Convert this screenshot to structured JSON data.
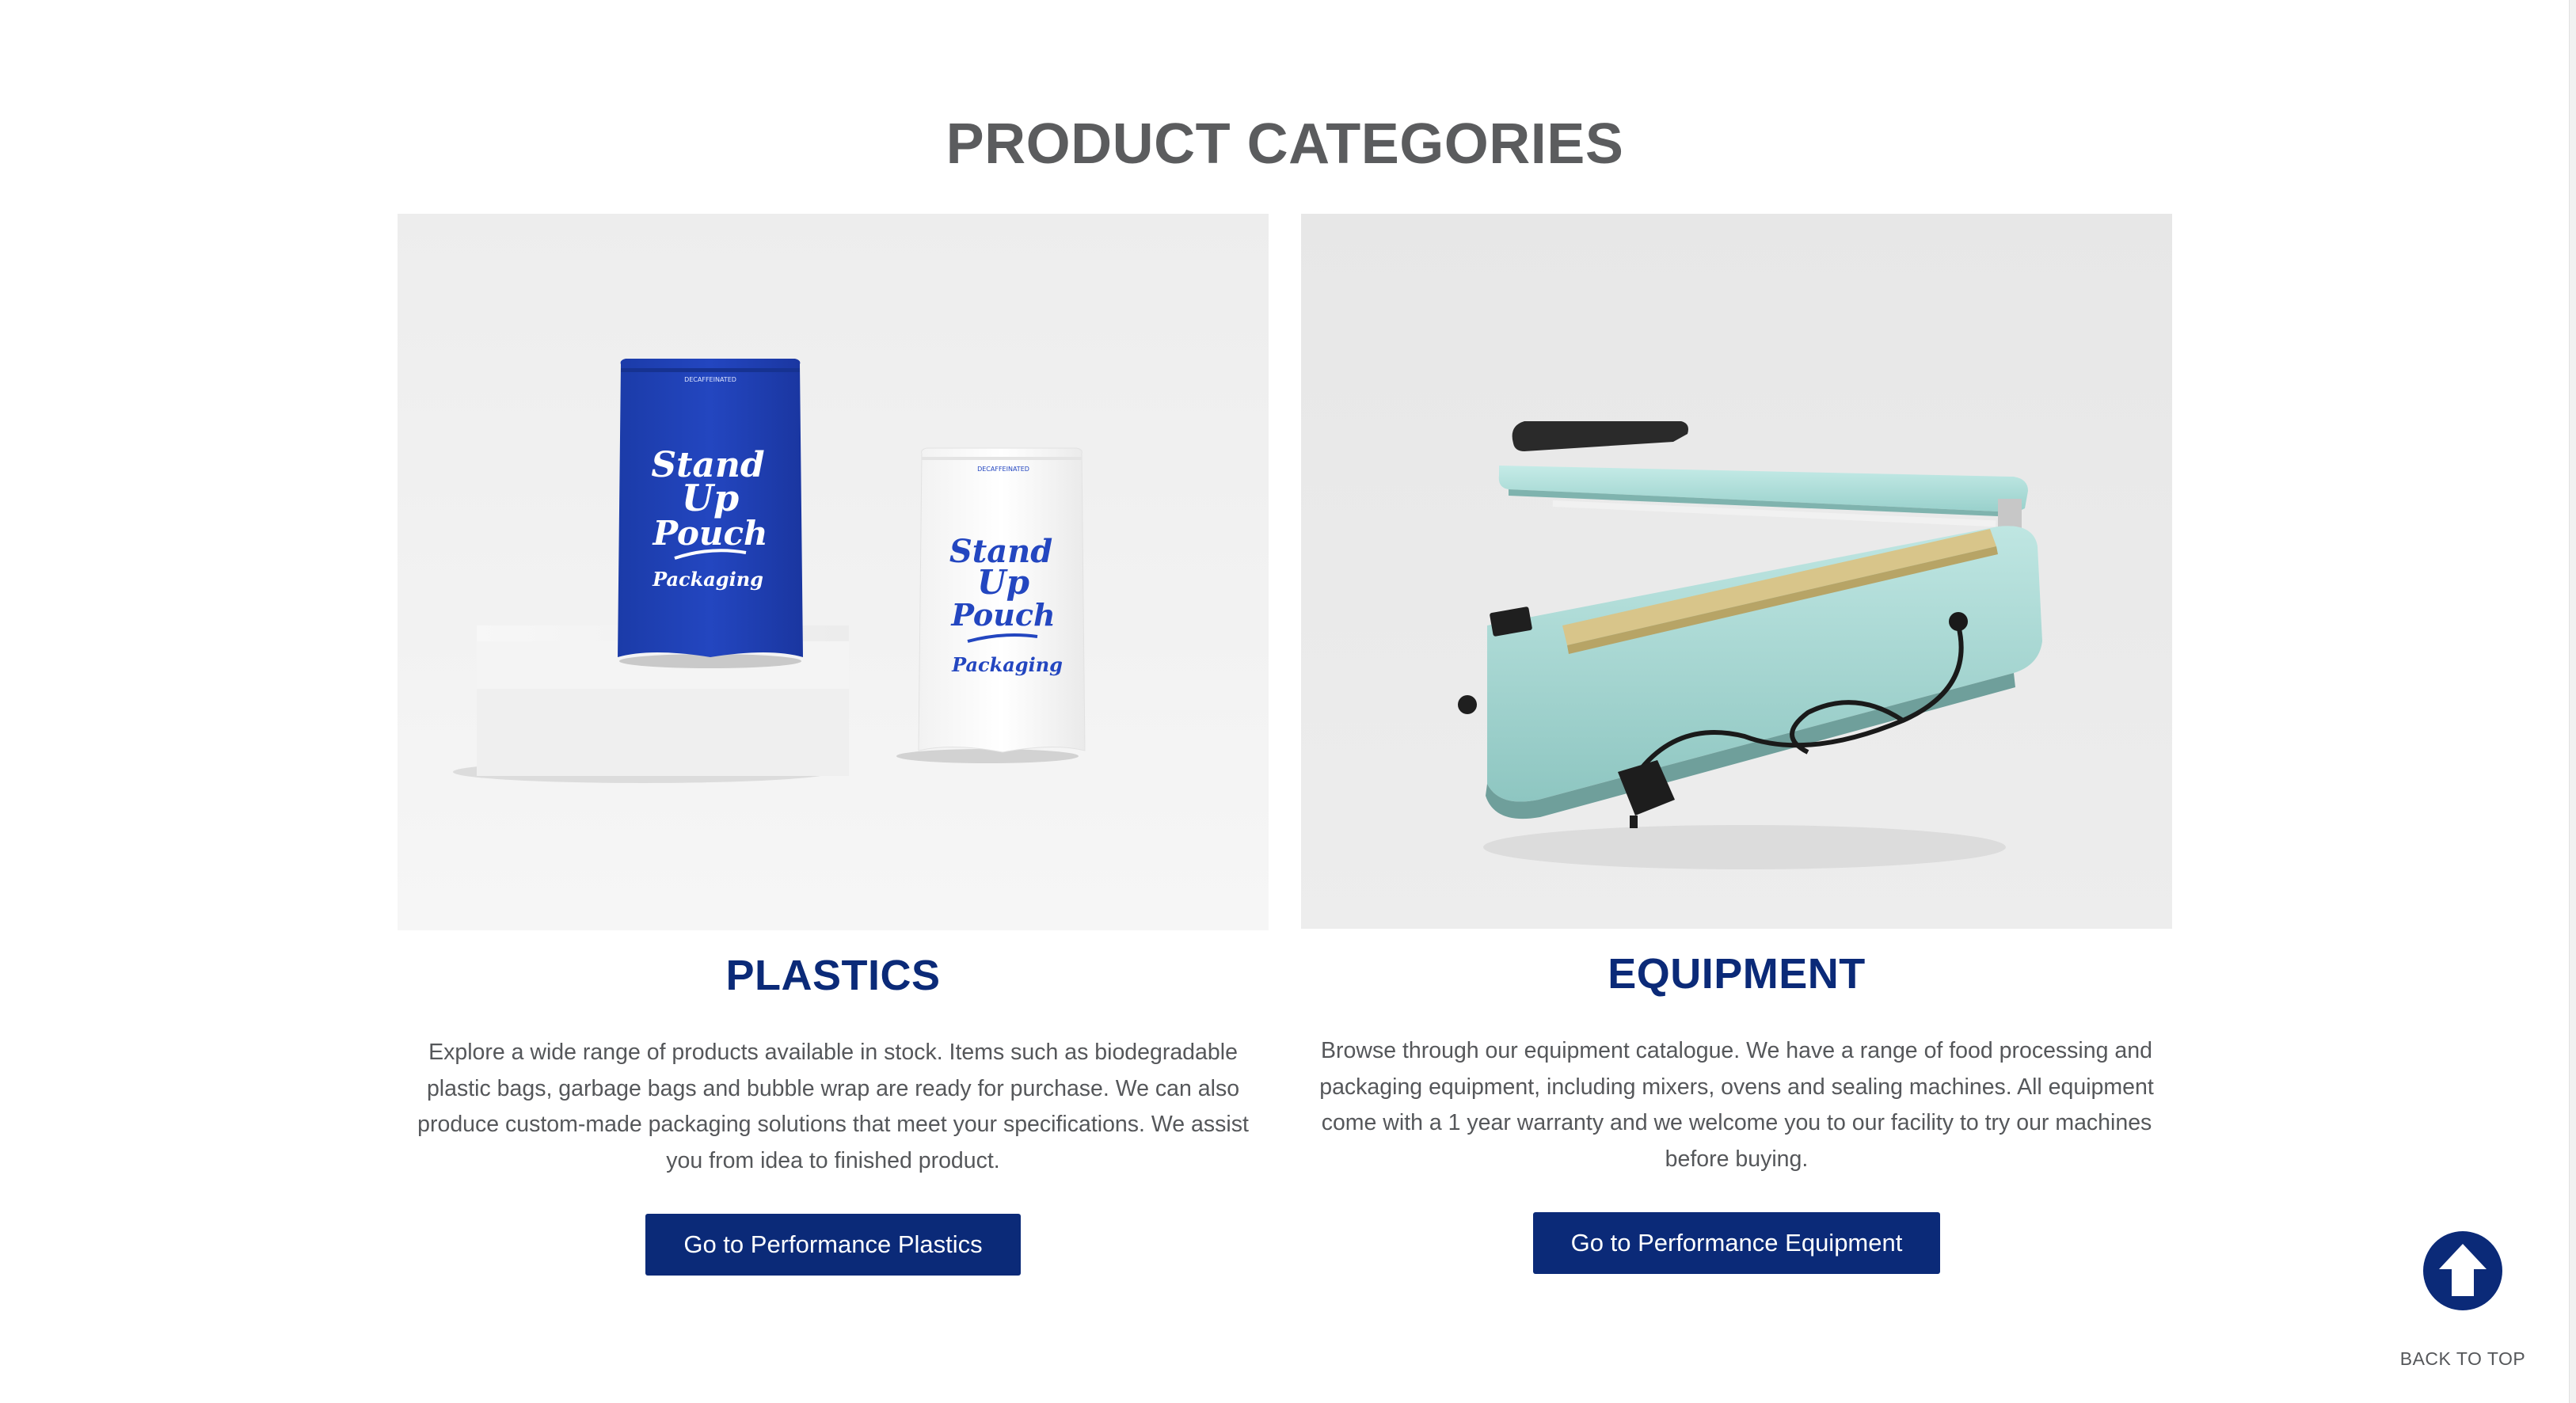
{
  "section": {
    "title": "PRODUCT CATEGORIES"
  },
  "cards": [
    {
      "title": "PLASTICS",
      "description": "Explore a wide range of products available in stock. Items such as biodegradable plastic bags, garbage bags and bubble wrap are ready for purchase. We can also produce custom-made packaging solutions that meet your specifications. We assist you from idea to finished product.",
      "button_label": "Go to Performance Plastics",
      "image": {
        "pouch_top_label": "DECAFFEINATED",
        "pouch_text_line1": "Stand",
        "pouch_text_line2": "Up",
        "pouch_text_line3": "Pouch",
        "pouch_text_line4": "Packaging"
      }
    },
    {
      "title": "EQUIPMENT",
      "description": "Browse through our equipment catalogue. We have a range of food processing and packaging equipment, including mixers, ovens and sealing machines. All equipment come with a 1 year warranty and we welcome you to our facility to try our machines before buying.",
      "button_label": "Go to Performance Equipment"
    }
  ],
  "back_to_top": {
    "label": "BACK TO TOP",
    "icon": "arrow-up-circle-icon"
  },
  "colors": {
    "brand_blue": "#0b2a78",
    "heading_gray": "#5b5c5e",
    "text_gray": "#55575a",
    "image_bg": "#e9e9e9",
    "sealer_teal": "#a9d8d4"
  }
}
